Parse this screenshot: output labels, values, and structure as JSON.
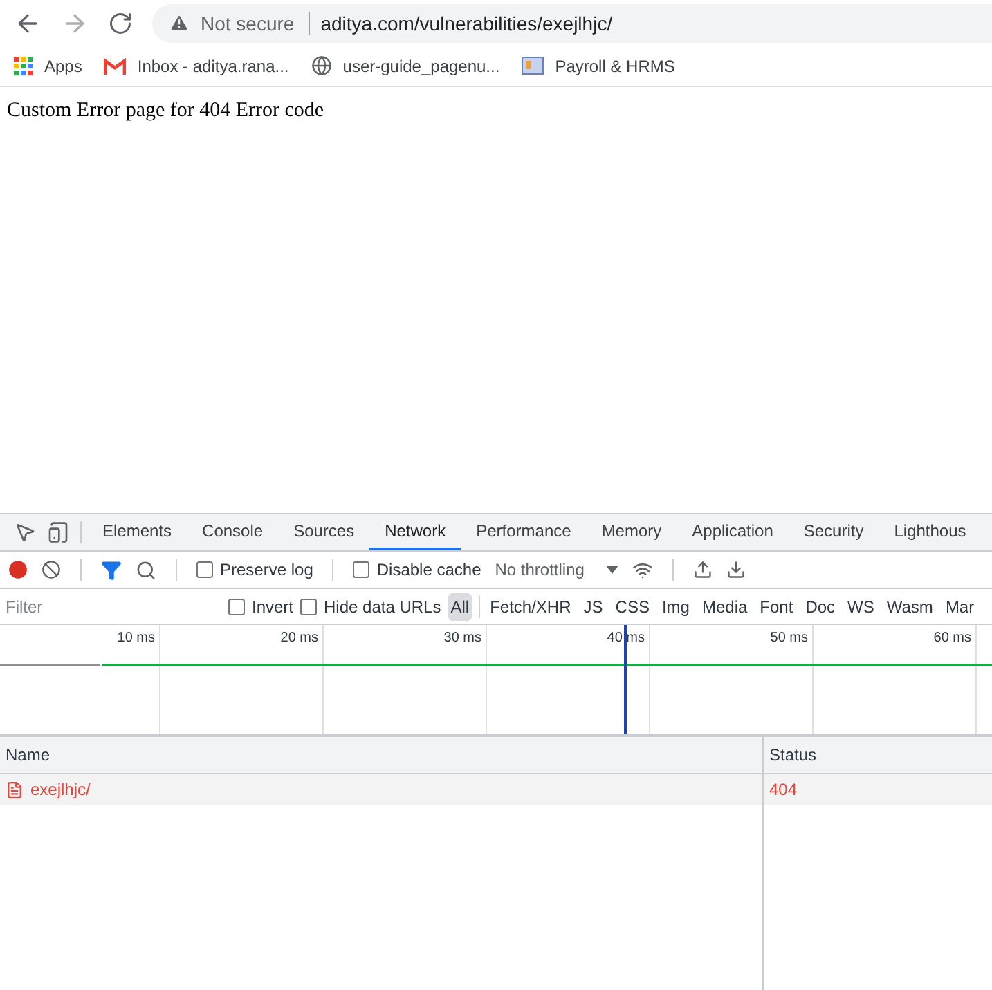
{
  "browser": {
    "security_label": "Not secure",
    "url": "aditya.com/vulnerabilities/exejlhjc/",
    "bookmarks": [
      {
        "kind": "apps",
        "label": "Apps"
      },
      {
        "kind": "mail",
        "label": "Inbox - aditya.rana..."
      },
      {
        "kind": "globe",
        "label": "user-guide_pagenu..."
      },
      {
        "kind": "card",
        "label": "Payroll & HRMS"
      }
    ]
  },
  "page": {
    "text": "Custom Error page for 404 Error code"
  },
  "devtools": {
    "tabs": [
      {
        "label": "Elements",
        "selected": false
      },
      {
        "label": "Console",
        "selected": false
      },
      {
        "label": "Sources",
        "selected": false
      },
      {
        "label": "Network",
        "selected": true
      },
      {
        "label": "Performance",
        "selected": false
      },
      {
        "label": "Memory",
        "selected": false
      },
      {
        "label": "Application",
        "selected": false
      },
      {
        "label": "Security",
        "selected": false
      },
      {
        "label": "Lighthous",
        "selected": false
      }
    ],
    "toolbar": {
      "preserve_log": {
        "label": "Preserve log",
        "checked": false
      },
      "disable_cache": {
        "label": "Disable cache",
        "checked": false
      },
      "throttling": "No throttling"
    },
    "filter": {
      "placeholder": "Filter",
      "invert": {
        "label": "Invert",
        "checked": false
      },
      "hide_data_urls": {
        "label": "Hide data URLs",
        "checked": false
      },
      "types": [
        {
          "label": "All",
          "selected": true
        },
        {
          "label": "Fetch/XHR",
          "selected": false
        },
        {
          "label": "JS",
          "selected": false
        },
        {
          "label": "CSS",
          "selected": false
        },
        {
          "label": "Img",
          "selected": false
        },
        {
          "label": "Media",
          "selected": false
        },
        {
          "label": "Font",
          "selected": false
        },
        {
          "label": "Doc",
          "selected": false
        },
        {
          "label": "WS",
          "selected": false
        },
        {
          "label": "Wasm",
          "selected": false
        },
        {
          "label": "Mar",
          "selected": false
        }
      ]
    },
    "timeline_ticks": [
      "10 ms",
      "20 ms",
      "30 ms",
      "40 ms",
      "50 ms",
      "60 ms"
    ],
    "table": {
      "columns": [
        "Name",
        "Status"
      ],
      "rows": [
        {
          "name": "exejlhjc/",
          "status": "404",
          "error": true
        }
      ]
    }
  }
}
